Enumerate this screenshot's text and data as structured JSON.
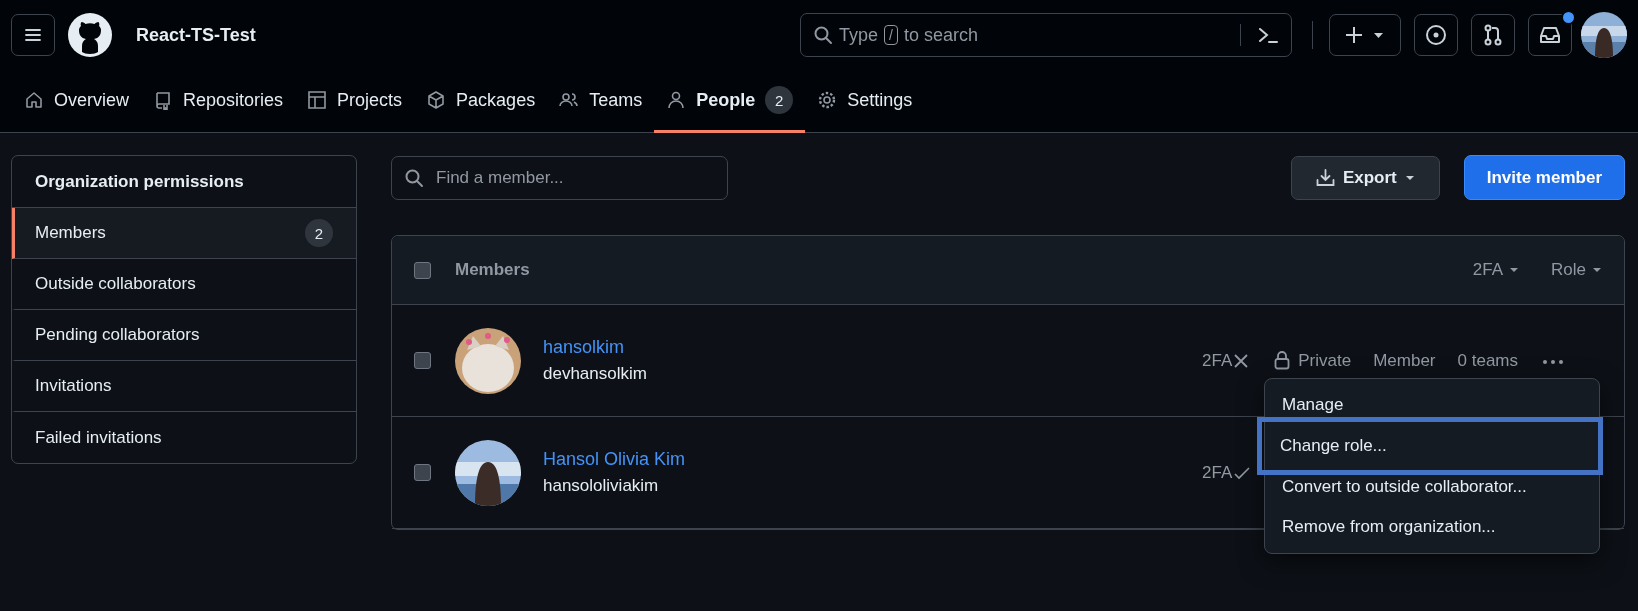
{
  "header": {
    "repo_name": "React-TS-Test",
    "search": {
      "prefix": "Type",
      "key": "/",
      "suffix": "to search"
    },
    "inbox_unread": true
  },
  "nav": [
    {
      "label": "Overview",
      "selected": false
    },
    {
      "label": "Repositories",
      "selected": false
    },
    {
      "label": "Projects",
      "selected": false
    },
    {
      "label": "Packages",
      "selected": false
    },
    {
      "label": "Teams",
      "selected": false
    },
    {
      "label": "People",
      "selected": true,
      "counter": "2"
    },
    {
      "label": "Settings",
      "selected": false
    }
  ],
  "sidebar": {
    "title": "Organization permissions",
    "items": [
      {
        "label": "Members",
        "selected": true,
        "counter": "2"
      },
      {
        "label": "Outside collaborators",
        "selected": false
      },
      {
        "label": "Pending collaborators",
        "selected": false
      },
      {
        "label": "Invitations",
        "selected": false
      },
      {
        "label": "Failed invitations",
        "selected": false
      }
    ]
  },
  "search": {
    "placeholder": "Find a member..."
  },
  "export_button": "Export",
  "invite_button": "Invite member",
  "table": {
    "header": {
      "label": "Members",
      "checked": false,
      "filters": [
        "2FA",
        "Role"
      ]
    },
    "rows": [
      {
        "name": "hansolkim",
        "login": "devhansolkim",
        "checked": false,
        "twofa_label": "2FA",
        "twofa": false,
        "visibility": "Private",
        "role": "Member",
        "teams": "0 teams"
      },
      {
        "name": "Hansol Olivia Kim",
        "login": "hansololiviakim",
        "checked": false,
        "twofa_label": "2FA",
        "twofa": true
      }
    ]
  },
  "menu": {
    "items": [
      {
        "label": "Manage",
        "selected": false
      },
      {
        "label": "Change role...",
        "selected": true
      },
      {
        "label": "Convert to outside collaborator...",
        "selected": false
      },
      {
        "label": "Remove from organization...",
        "selected": false
      }
    ]
  }
}
